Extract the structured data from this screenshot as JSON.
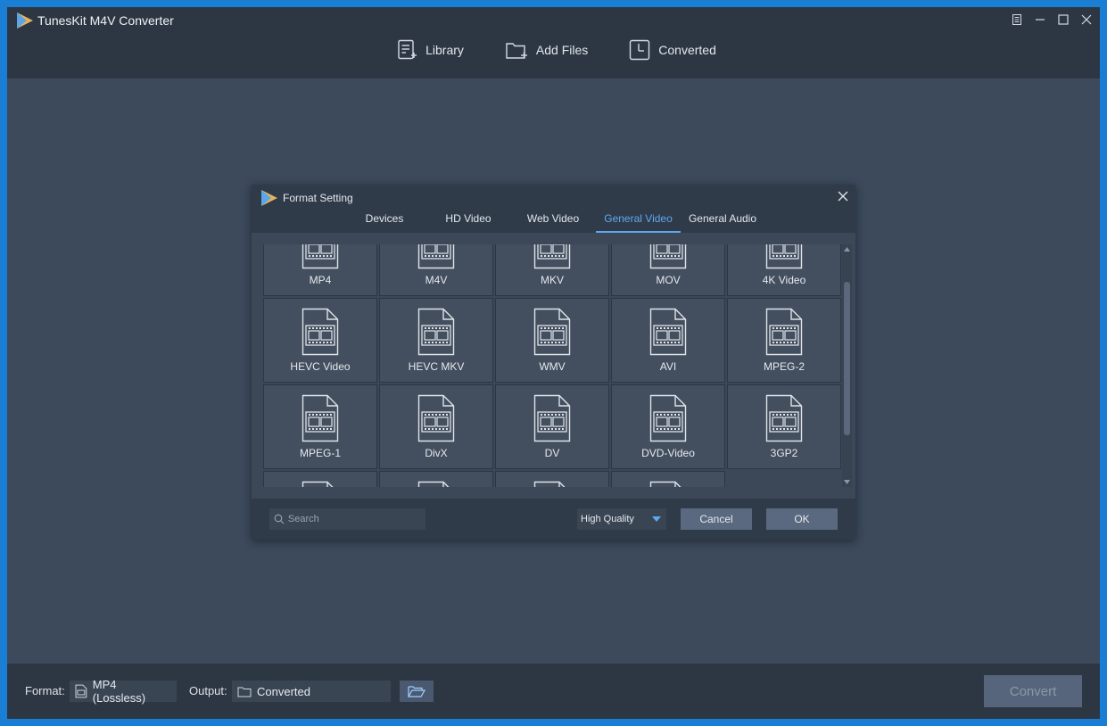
{
  "app": {
    "title": "TunesKit M4V Converter"
  },
  "nav": {
    "library": "Library",
    "add_files": "Add Files",
    "converted": "Converted"
  },
  "dialog": {
    "title": "Format Setting",
    "tabs": [
      "Devices",
      "HD Video",
      "Web Video",
      "General Video",
      "General Audio"
    ],
    "active_tab": "General Video",
    "formats": [
      "MP4",
      "M4V",
      "MKV",
      "MOV",
      "4K Video",
      "HEVC Video",
      "HEVC MKV",
      "WMV",
      "AVI",
      "MPEG-2",
      "MPEG-1",
      "DivX",
      "DV",
      "DVD-Video",
      "3GP2",
      "",
      "",
      "",
      ""
    ],
    "search_placeholder": "Search",
    "quality": "High Quality",
    "cancel": "Cancel",
    "ok": "OK"
  },
  "bottombar": {
    "format_label": "Format:",
    "format_value": "MP4 (Lossless)",
    "output_label": "Output:",
    "output_value": "Converted",
    "convert": "Convert"
  },
  "colors": {
    "accent": "#5fa8f0",
    "window_bg": "#3c4a5c",
    "bar_bg": "#2d3744",
    "desktop": "#1a7fd4"
  }
}
